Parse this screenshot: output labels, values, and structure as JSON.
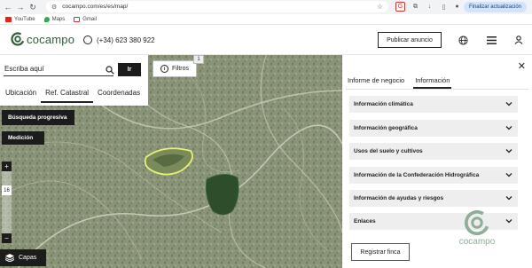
{
  "browser": {
    "url": "cocampo.com/es/es/map/",
    "update_label": "Finalizar actualización"
  },
  "bookmarks": [
    {
      "label": "YouTube",
      "icon": "youtube-icon",
      "color": "#e62117"
    },
    {
      "label": "Maps",
      "icon": "maps-icon",
      "color": "#34a853"
    },
    {
      "label": "Gmail",
      "icon": "gmail-icon",
      "color": "#d93025"
    }
  ],
  "header": {
    "logo_text": "cocampo",
    "phone": "(+34) 623 380 922",
    "publish_label": "Publicar anuncio"
  },
  "search": {
    "placeholder": "Escriba aquí",
    "go_label": "Ir",
    "tabs": [
      "Ubicación",
      "Ref. Catastral",
      "Coordenadas"
    ],
    "active_tab": "Ref. Catastral"
  },
  "filters": {
    "label": "Filtros",
    "count": "1"
  },
  "map_controls": {
    "progressive_search": "Búsqueda progresiva",
    "measure": "Medición",
    "zoom_in": "+",
    "zoom_out": "−",
    "zoom_level": "16",
    "layers": "Capas"
  },
  "info_panel": {
    "tabs": [
      "Informe de negocio",
      "Información"
    ],
    "active_tab": "Información",
    "sections": [
      "Información climática",
      "Información geográfica",
      "Usos del suelo y cultivos",
      "Información de la Confederación Hidrográfica",
      "Información de ayudas y riesgos",
      "Enlaces"
    ],
    "register_label": "Registrar finca",
    "watermark_text": "cocampo"
  },
  "colors": {
    "brand_green": "#2f5d3a",
    "dark_button": "#1c1c1c",
    "accordion_bg": "#eeeeee",
    "map_base": "#8a9478",
    "highlight_parcel": "#e8f07a",
    "selected_parcel": "#2e4d2a"
  }
}
